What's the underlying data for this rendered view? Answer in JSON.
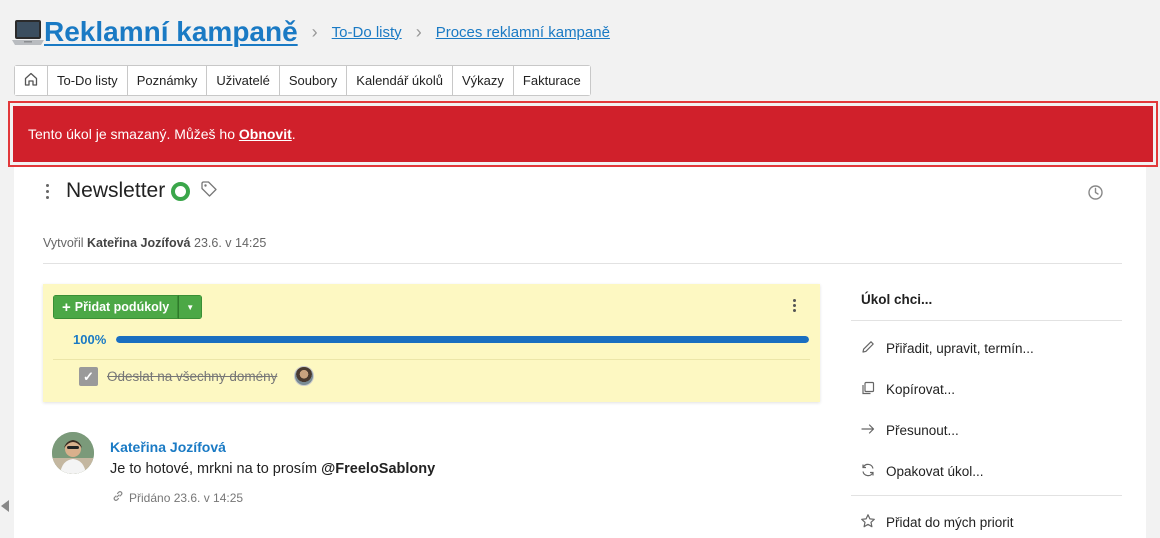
{
  "header": {
    "title": "Reklamní kampaně",
    "breadcrumbs": [
      "To-Do listy",
      "Proces reklamní kampaně"
    ]
  },
  "tabs": [
    "To-Do listy",
    "Poznámky",
    "Uživatelé",
    "Soubory",
    "Kalendář úkolů",
    "Výkazy",
    "Fakturace"
  ],
  "alert": {
    "text": "Tento úkol je smazaný. Můžeš ho ",
    "link": "Obnovit",
    "suffix": "."
  },
  "task": {
    "title": "Newsletter",
    "meta_prefix": "Vytvořil",
    "meta_author": "Kateřina Jozífová",
    "meta_date": "23.6. v 14:25"
  },
  "subtasks": {
    "add_label": "Přidat podúkoly",
    "progress_label": "100%",
    "progress": 1.0,
    "items": [
      {
        "label": "Odeslat na všechny domény",
        "done": true
      }
    ]
  },
  "comment": {
    "author": "Kateřina Jozífová",
    "text": "Je to hotové, mrkni na to prosím ",
    "mention": "@FreeloSablony",
    "added": "Přidáno 23.6. v 14:25"
  },
  "right_panel": {
    "title": "Úkol chci...",
    "items": [
      "Přiřadit, upravit, termín...",
      "Kopírovat...",
      "Přesunout...",
      "Opakovat úkol...",
      "Přidat do mých priorit"
    ]
  },
  "colors": {
    "accent": "#1a7ac4",
    "alert_bg": "#d0202b",
    "success": "#4ca846",
    "subtask_bg": "#fdf8c2"
  }
}
